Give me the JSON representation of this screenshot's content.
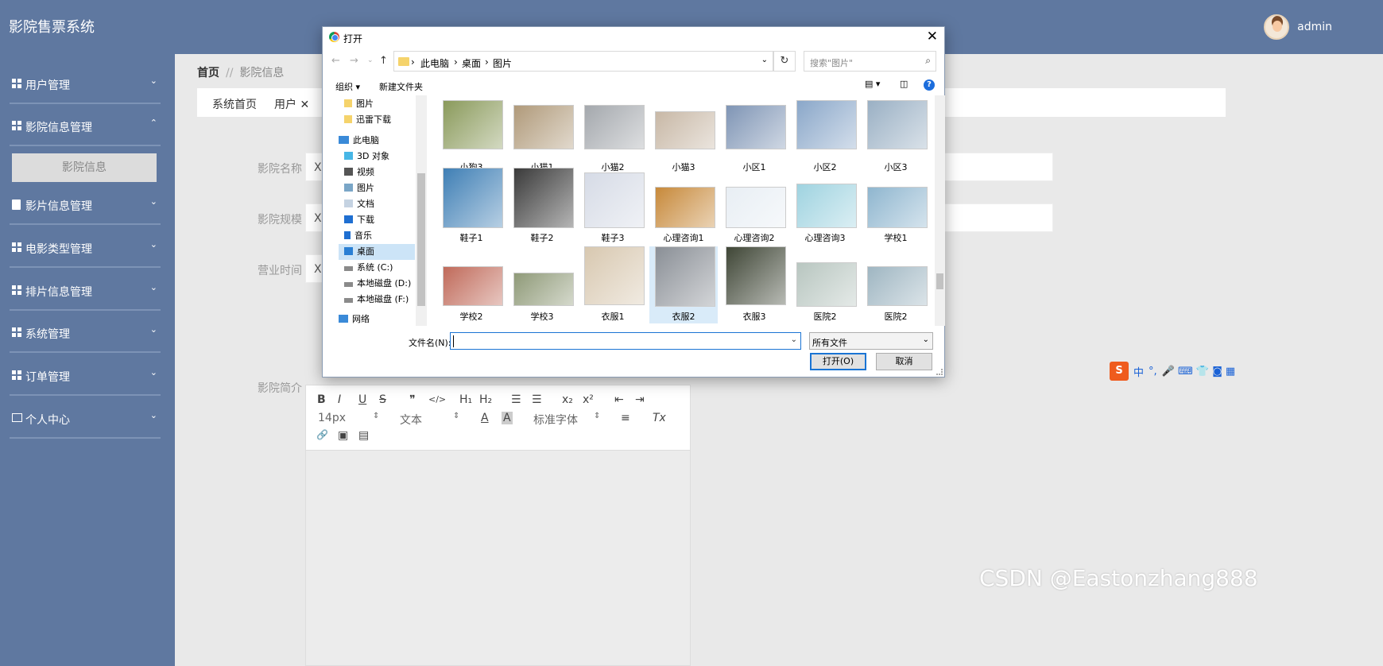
{
  "app": {
    "title": "影院售票系统",
    "user": "admin"
  },
  "sidebar": {
    "items": [
      {
        "label": "用户管理",
        "chevron": "⌄"
      },
      {
        "label": "影院信息管理",
        "chevron": "⌃"
      },
      {
        "label": "影片信息管理",
        "chevron": "⌄"
      },
      {
        "label": "电影类型管理",
        "chevron": "⌄"
      },
      {
        "label": "排片信息管理",
        "chevron": "⌄"
      },
      {
        "label": "系统管理",
        "chevron": "⌄"
      },
      {
        "label": "订单管理",
        "chevron": "⌄"
      },
      {
        "label": "个人中心",
        "chevron": "⌄"
      }
    ],
    "active_sub": "影院信息"
  },
  "breadcrumb": {
    "home": "首页",
    "sep": "//",
    "current": "影院信息"
  },
  "tabs": [
    {
      "label": "系统首页"
    },
    {
      "label": "用户 ✕"
    }
  ],
  "form": {
    "name_label": "影院名称",
    "name_value": "X",
    "scale_label": "影院规模",
    "scale_value": "X",
    "hours_label": "营业时间",
    "hours_value": "X",
    "intro_label": "影院简介"
  },
  "editor": {
    "font_size": "14px",
    "text_type": "文本",
    "font_family": "标准字体",
    "toolbar_glyphs": {
      "bold": "B",
      "italic": "I",
      "underline": "U",
      "strike": "S",
      "quote": "❞",
      "code": "</>",
      "h1": "H₁",
      "h2": "H₂",
      "ol": "☰",
      "ul": "☰",
      "sub": "x₂",
      "sup": "x²",
      "outdent": "⇤",
      "indent": "⇥",
      "color": "A",
      "bg": "A",
      "align": "≡",
      "clear": "Tx",
      "link": "🔗",
      "image": "▣",
      "video": "▤",
      "arrows": "⇕"
    }
  },
  "dialog": {
    "title": "打开",
    "close": "✕",
    "path": [
      "此电脑",
      "桌面",
      "图片"
    ],
    "path_sep": "›",
    "search_placeholder": "搜索\"图片\"",
    "organize": "组织 ▾",
    "new_folder": "新建文件夹",
    "help": "?",
    "nav": [
      {
        "label": "图片",
        "icon": "folder-icon"
      },
      {
        "label": "迅雷下载",
        "icon": "folder-icon"
      },
      {
        "label": "此电脑",
        "icon": "computer-icon"
      },
      {
        "label": "3D 对象",
        "icon": "cube-icon"
      },
      {
        "label": "视频",
        "icon": "video-icon"
      },
      {
        "label": "图片",
        "icon": "picture-icon"
      },
      {
        "label": "文档",
        "icon": "document-icon"
      },
      {
        "label": "下载",
        "icon": "download-icon"
      },
      {
        "label": "音乐",
        "icon": "music-icon"
      },
      {
        "label": "桌面",
        "icon": "desktop-icon"
      },
      {
        "label": "系统 (C:)",
        "icon": "drive-icon"
      },
      {
        "label": "本地磁盘 (D:)",
        "icon": "drive-icon"
      },
      {
        "label": "本地磁盘 (F:)",
        "icon": "drive-icon"
      },
      {
        "label": "网络",
        "icon": "network-icon"
      }
    ],
    "files": [
      {
        "name": "小狗3",
        "color": "#8a9a5b"
      },
      {
        "name": "小猫1",
        "color": "#b09a7a"
      },
      {
        "name": "小猫2",
        "color": "#a4a8ad"
      },
      {
        "name": "小猫3",
        "color": "#c8b8a6"
      },
      {
        "name": "小区1",
        "color": "#7f95b5"
      },
      {
        "name": "小区2",
        "color": "#8aa7c9"
      },
      {
        "name": "小区3",
        "color": "#9ab0c4"
      },
      {
        "name": "鞋子1",
        "color": "#3f7fb5"
      },
      {
        "name": "鞋子2",
        "color": "#3a3a3a"
      },
      {
        "name": "鞋子3",
        "color": "#d6dbe6"
      },
      {
        "name": "心理咨询1",
        "color": "#c7893a"
      },
      {
        "name": "心理咨询2",
        "color": "#e8eef4"
      },
      {
        "name": "心理咨询3",
        "color": "#9fd3e0"
      },
      {
        "name": "学校1",
        "color": "#8fb6cf"
      },
      {
        "name": "学校2",
        "color": "#c06a5a"
      },
      {
        "name": "学校3",
        "color": "#8f9a78"
      },
      {
        "name": "衣服1",
        "color": "#d8c8b0"
      },
      {
        "name": "衣服2",
        "color": "#8a8f96"
      },
      {
        "name": "衣服3",
        "color": "#3f4636"
      },
      {
        "name": "医院2",
        "color": "#b8c6c0"
      },
      {
        "name": "医院2",
        "color": "#9fb6c2"
      }
    ],
    "filename_label": "文件名(N):",
    "filename_value": "",
    "filetype": "所有文件",
    "open_button": "打开(O)",
    "cancel_button": "取消"
  },
  "ime": {
    "logo": "S",
    "mode": "中",
    "punct": "°,",
    "extra": "🎤 ⌨ 👕 ◙ ▦"
  },
  "watermark": "CSDN @Eastonzhang888"
}
